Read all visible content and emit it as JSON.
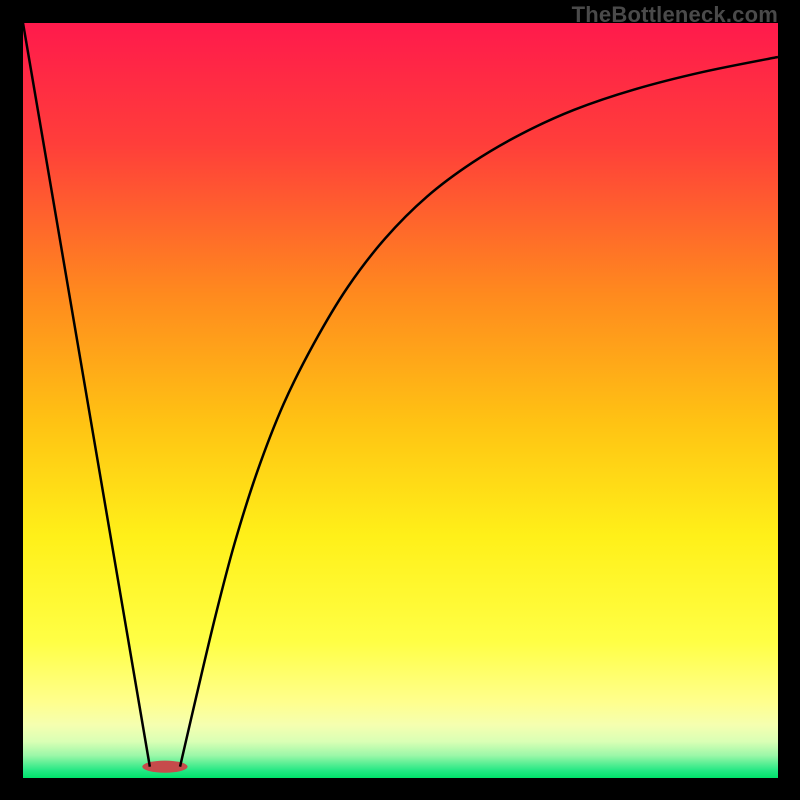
{
  "watermark": "TheBottleneck.com",
  "chart_data": {
    "type": "line",
    "title": "",
    "xlabel": "",
    "ylabel": "",
    "xlim": [
      0,
      1
    ],
    "ylim": [
      0,
      1
    ],
    "gradient_stops": [
      {
        "y": 1.0,
        "color": "#ff1a4c"
      },
      {
        "y": 0.84,
        "color": "#ff3e3a"
      },
      {
        "y": 0.64,
        "color": "#ff8a1e"
      },
      {
        "y": 0.47,
        "color": "#ffc313"
      },
      {
        "y": 0.32,
        "color": "#fff019"
      },
      {
        "y": 0.18,
        "color": "#ffff45"
      },
      {
        "y": 0.1,
        "color": "#ffff8e"
      },
      {
        "y": 0.07,
        "color": "#f5ffb0"
      },
      {
        "y": 0.048,
        "color": "#d9ffb5"
      },
      {
        "y": 0.03,
        "color": "#9cf7a8"
      },
      {
        "y": 0.01,
        "color": "#24e884"
      },
      {
        "y": 0.0,
        "color": "#00e26a"
      }
    ],
    "series": [
      {
        "name": "left-segment",
        "x": [
          0.0,
          0.168
        ],
        "y": [
          1.0,
          0.015
        ]
      },
      {
        "name": "right-curve",
        "x": [
          0.208,
          0.23,
          0.255,
          0.28,
          0.31,
          0.345,
          0.385,
          0.43,
          0.48,
          0.535,
          0.595,
          0.66,
          0.73,
          0.81,
          0.9,
          1.0
        ],
        "y": [
          0.015,
          0.11,
          0.215,
          0.31,
          0.405,
          0.495,
          0.575,
          0.65,
          0.715,
          0.77,
          0.815,
          0.853,
          0.885,
          0.912,
          0.935,
          0.955
        ]
      }
    ],
    "hotspot": {
      "cx": 0.188,
      "cy": 0.015,
      "rx": 0.03,
      "ry": 0.008,
      "color": "#c64b4b"
    }
  }
}
